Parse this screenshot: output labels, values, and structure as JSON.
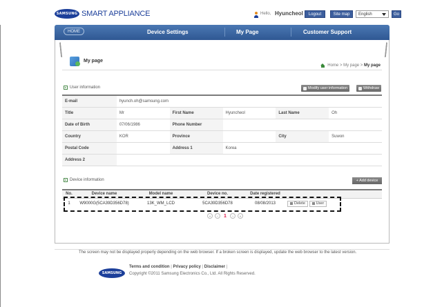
{
  "header": {
    "logo_badge": "SAMSUNG",
    "app_name": "SMART APPLIANCE",
    "hello": "Hello,",
    "user_name": "Hyuncheol",
    "logout_label": "Logout",
    "sitemap_label": "Site map",
    "language": "English",
    "go_label": "Go"
  },
  "nav": {
    "home": "HOME",
    "items": [
      "Device Settings",
      "My Page",
      "Customer Support"
    ]
  },
  "page": {
    "title": "My page",
    "breadcrumb": [
      "Home",
      "My page",
      "My page"
    ]
  },
  "user_info": {
    "heading": "User information",
    "modify_label": "Modify user information",
    "withdraw_label": "Withdraw",
    "email_label": "E-mail",
    "email": "hyunch.oh@samsung.com",
    "title_label": "Title",
    "title": "Mr",
    "first_name_label": "First Name",
    "first_name": "Hyuncheol",
    "last_name_label": "Last Name",
    "last_name": "Oh",
    "dob_label": "Date of Birth",
    "dob": "07/06/1986",
    "phone_label": "Phone Number",
    "phone": "",
    "country_label": "Country",
    "country": "KOR",
    "province_label": "Province",
    "province": "",
    "city_label": "City",
    "city": "Suwon",
    "postal_label": "Postal Code",
    "postal": "",
    "address1_label": "Address 1",
    "address1": "Korea",
    "address2_label": "Address 2",
    "address2": ""
  },
  "devices": {
    "heading": "Device information",
    "add_label": "+ Add device",
    "columns": [
      "No.",
      "Device name",
      "Model name",
      "Device no.",
      "Date registered"
    ],
    "rows": [
      {
        "no": "1",
        "device_name": "W9000G(5CA39D356D78)",
        "model_name": "13K_WM_LCD",
        "device_no": "5CA39D356D78",
        "date": "08/08/2013",
        "delete_label": "Delete",
        "user_label": "User"
      }
    ]
  },
  "pager": {
    "first": "«",
    "prev": "‹",
    "current": "1",
    "next": "›",
    "last": "»"
  },
  "footer": {
    "note": "The screen may not be displayed properly depending on the web browser. If a broken screen is displayed, update the web browser to the latest version.",
    "logo_badge": "SAMSUNG",
    "terms": "Terms and condition",
    "privacy": "Privacy policy",
    "disclaimer": "Disclaimer",
    "copyright": "Copyright ©2011 Samsung Electronics Co., Ltd. All Rights Reserved."
  }
}
